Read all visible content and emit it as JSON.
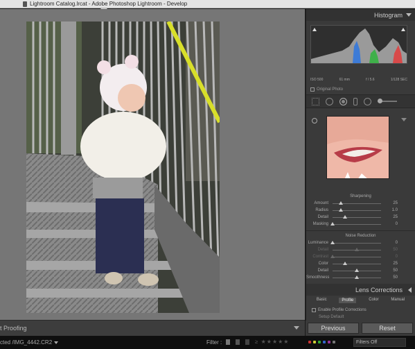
{
  "window": {
    "title": "Lightroom Catalog.lrcat - Adobe Photoshop Lightroom - Develop"
  },
  "panels": {
    "histogram": {
      "title": "Histogram",
      "info": {
        "iso": "ISO 500",
        "focal": "61 mm",
        "aperture": "f / 5.6",
        "shutter": "1/128 SEC"
      },
      "original_photo_label": "Original Photo"
    },
    "detail": {
      "sharpening": {
        "title": "Sharpening",
        "sliders": [
          {
            "label": "Amount",
            "value": "25",
            "pos": 0.17
          },
          {
            "label": "Radius",
            "value": "1.0",
            "pos": 0.17
          },
          {
            "label": "Detail",
            "value": "25",
            "pos": 0.25
          },
          {
            "label": "Masking",
            "value": "0",
            "pos": 0.0
          }
        ]
      },
      "noise_reduction": {
        "title": "Noise Reduction",
        "sliders": [
          {
            "label": "Luminance",
            "value": "0",
            "pos": 0.0,
            "dim": false
          },
          {
            "label": "Detail",
            "value": "50",
            "pos": 0.5,
            "dim": true
          },
          {
            "label": "Contrast",
            "value": "0",
            "pos": 0.0,
            "dim": true
          },
          {
            "label": "Color",
            "value": "25",
            "pos": 0.25,
            "dim": false
          },
          {
            "label": "Detail",
            "value": "50",
            "pos": 0.5,
            "dim": false
          },
          {
            "label": "Smoothness",
            "value": "50",
            "pos": 0.5,
            "dim": false
          }
        ]
      }
    },
    "lens_corrections": {
      "title": "Lens Corrections",
      "tabs": [
        "Basic",
        "Profile",
        "Color",
        "Manual"
      ],
      "active_tab": "Profile",
      "enable_label": "Enable Profile Corrections",
      "setup_label": "Setup",
      "setup_value": "Default"
    }
  },
  "actions": {
    "previous": "Previous",
    "reset": "Reset"
  },
  "bottom": {
    "soft_proofing": "t Proofing",
    "filename": "cted /IMG_4442.CR2",
    "filter_label": "Filter :",
    "filters_off": "Filters Off"
  },
  "colors": {
    "accent": "#e6e600",
    "panel_bg": "#3a3a3a",
    "canvas_bg": "#767676"
  }
}
